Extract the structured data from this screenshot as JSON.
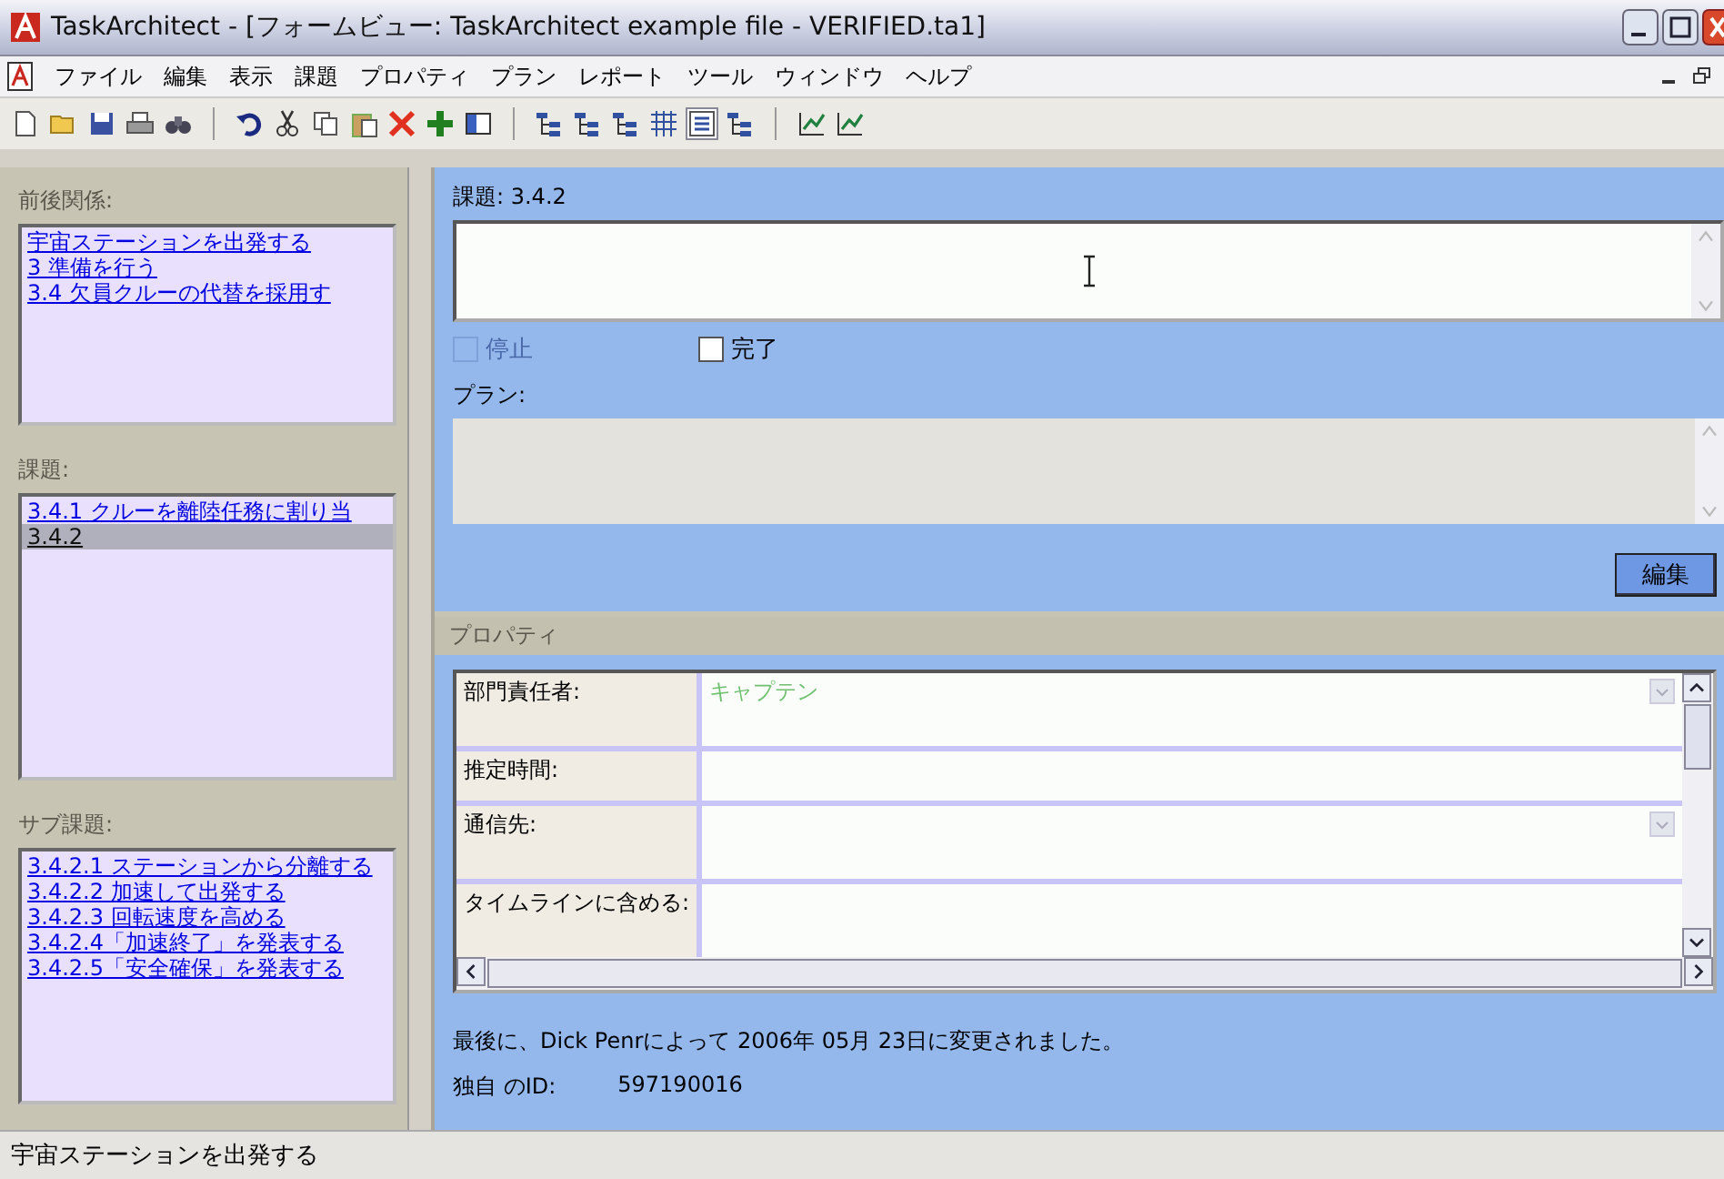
{
  "window": {
    "title": "TaskArchitect - [フォームビュー: TaskArchitect example file - VERIFIED.ta1]"
  },
  "menu": [
    "ファイル",
    "編集",
    "表示",
    "課題",
    "プロパティ",
    "プラン",
    "レポート",
    "ツール",
    "ウィンドウ",
    "ヘルプ"
  ],
  "sidebar": {
    "sections": [
      {
        "title": "前後関係:",
        "items": [
          {
            "label": "宇宙ステーションを出発する",
            "selected": false
          },
          {
            "label": "3 準備を行う",
            "selected": false
          },
          {
            "label": "3.4 欠員クルーの代替を採用す",
            "selected": false
          }
        ]
      },
      {
        "title": "課題:",
        "items": [
          {
            "label": "3.4.1 クルーを離陸任務に割り当",
            "selected": false
          },
          {
            "label": "3.4.2",
            "selected": true
          }
        ]
      },
      {
        "title": "サブ課題:",
        "items": [
          {
            "label": "3.4.2.1 ステーションから分離する",
            "selected": false
          },
          {
            "label": "3.4.2.2 加速して出発する",
            "selected": false
          },
          {
            "label": "3.4.2.3 回転速度を高める",
            "selected": false
          },
          {
            "label": "3.4.2.4「加速終了」を発表する",
            "selected": false
          },
          {
            "label": "3.4.2.5「安全確保」を発表する",
            "selected": false
          }
        ]
      }
    ]
  },
  "task": {
    "label": "課題: 3.4.2",
    "checkboxes": [
      {
        "label": "停止",
        "checked": false,
        "disabled": true
      },
      {
        "label": "完了",
        "checked": false,
        "disabled": false
      }
    ],
    "plan_label": "プラン:",
    "edit_button": "編集"
  },
  "properties": {
    "title": "プロパティ",
    "rows": [
      {
        "label": "部門責任者:",
        "value": "キャプテン",
        "dropdown": true
      },
      {
        "label": "推定時間:",
        "dropdown": false
      },
      {
        "label": "通信先:",
        "dropdown": true
      },
      {
        "label": "タイムラインに含める:",
        "dropdown": false
      }
    ],
    "modified": "最後に、Dick Penrによって 2006年 05月 23日に変更されました。",
    "id_label": "独自 のID:",
    "id_value": "597190016"
  },
  "status_bar": "宇宙ステーションを出発する"
}
